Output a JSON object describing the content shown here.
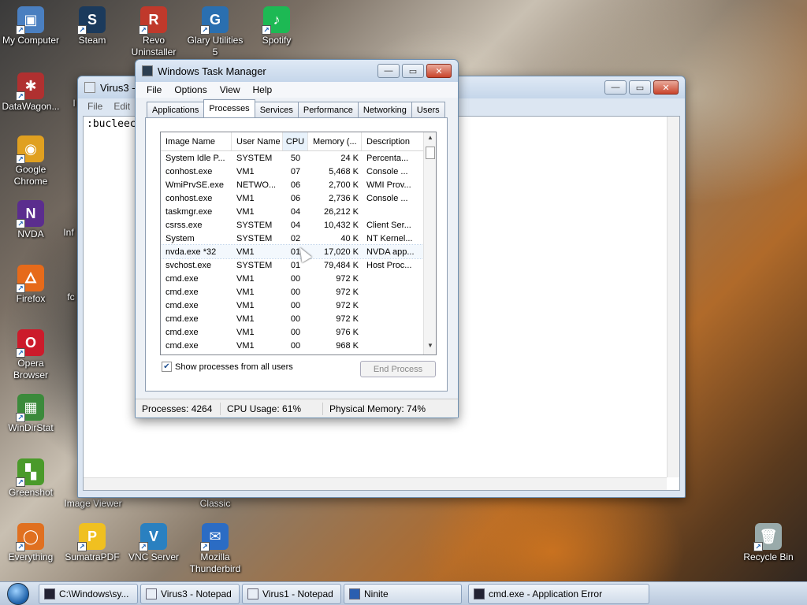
{
  "desktop_icons": [
    {
      "name": "My Computer",
      "color": "#4a7fc0",
      "glyph": "▣"
    },
    {
      "name": "Steam",
      "color": "#1b3a5c",
      "glyph": "S"
    },
    {
      "name": "Revo Uninstaller",
      "color": "#c0392b",
      "glyph": "R"
    },
    {
      "name": "Glary Utilities 5",
      "color": "#2a6fb0",
      "glyph": "G"
    },
    {
      "name": "Spotify",
      "color": "#1db954",
      "glyph": "♪"
    },
    {
      "name": "DataWagon...",
      "color": "#b03030",
      "glyph": "✱"
    },
    {
      "name": "Google Chrome",
      "color": "#e0a020",
      "glyph": "◉"
    },
    {
      "name": "NVDA",
      "color": "#5b2d8e",
      "glyph": "N"
    },
    {
      "name": "Firefox",
      "color": "#e66a1a",
      "glyph": "🜂"
    },
    {
      "name": "Opera Browser",
      "color": "#cc1b2b",
      "glyph": "O"
    },
    {
      "name": "WinDirStat",
      "color": "#3b8a3b",
      "glyph": "▦"
    },
    {
      "name": "Greenshot",
      "color": "#4a9a2a",
      "glyph": "▚"
    },
    {
      "name": "Everything",
      "color": "#e07020",
      "glyph": "◯"
    },
    {
      "name": "SumatraPDF",
      "color": "#f0c020",
      "glyph": "P"
    },
    {
      "name": "VNC Server",
      "color": "#2a80c0",
      "glyph": "V"
    },
    {
      "name": "Mozilla Thunderbird",
      "color": "#2b6cc4",
      "glyph": "✉"
    },
    {
      "name": "Recycle Bin",
      "color": "#9aa",
      "glyph": "🗑"
    }
  ],
  "partial_labels": {
    "inf": "Inf",
    "fc": "fc",
    "i": "I",
    "image_viewer": "Image Viewer",
    "classic": "Classic"
  },
  "notepad": {
    "title": "Virus3 - N",
    "menu": {
      "file": "File",
      "edit": "Edit"
    },
    "content": ":bucleec"
  },
  "taskmgr": {
    "title": "Windows Task Manager",
    "menu": {
      "file": "File",
      "options": "Options",
      "view": "View",
      "help": "Help"
    },
    "tabs": {
      "applications": "Applications",
      "processes": "Processes",
      "services": "Services",
      "performance": "Performance",
      "networking": "Networking",
      "users": "Users"
    },
    "columns": {
      "image": "Image Name",
      "user": "User Name",
      "cpu": "CPU",
      "memory": "Memory (...",
      "description": "Description"
    },
    "processes": [
      {
        "image": "System Idle P...",
        "user": "SYSTEM",
        "cpu": "50",
        "memory": "24 K",
        "description": "Percenta..."
      },
      {
        "image": "conhost.exe",
        "user": "VM1",
        "cpu": "07",
        "memory": "5,468 K",
        "description": "Console ..."
      },
      {
        "image": "WmiPrvSE.exe",
        "user": "NETWO...",
        "cpu": "06",
        "memory": "2,700 K",
        "description": "WMI Prov..."
      },
      {
        "image": "conhost.exe",
        "user": "VM1",
        "cpu": "06",
        "memory": "2,736 K",
        "description": "Console ..."
      },
      {
        "image": "taskmgr.exe",
        "user": "VM1",
        "cpu": "04",
        "memory": "26,212 K",
        "description": ""
      },
      {
        "image": "csrss.exe",
        "user": "SYSTEM",
        "cpu": "04",
        "memory": "10,432 K",
        "description": "Client Ser..."
      },
      {
        "image": "System",
        "user": "SYSTEM",
        "cpu": "02",
        "memory": "40 K",
        "description": "NT Kernel..."
      },
      {
        "image": "nvda.exe *32",
        "user": "VM1",
        "cpu": "01",
        "memory": "17,020 K",
        "description": "NVDA app..."
      },
      {
        "image": "svchost.exe",
        "user": "SYSTEM",
        "cpu": "01",
        "memory": "79,484 K",
        "description": "Host Proc..."
      },
      {
        "image": "cmd.exe",
        "user": "VM1",
        "cpu": "00",
        "memory": "972 K",
        "description": ""
      },
      {
        "image": "cmd.exe",
        "user": "VM1",
        "cpu": "00",
        "memory": "972 K",
        "description": ""
      },
      {
        "image": "cmd.exe",
        "user": "VM1",
        "cpu": "00",
        "memory": "972 K",
        "description": ""
      },
      {
        "image": "cmd.exe",
        "user": "VM1",
        "cpu": "00",
        "memory": "972 K",
        "description": ""
      },
      {
        "image": "cmd.exe",
        "user": "VM1",
        "cpu": "00",
        "memory": "976 K",
        "description": ""
      },
      {
        "image": "cmd.exe",
        "user": "VM1",
        "cpu": "00",
        "memory": "968 K",
        "description": ""
      }
    ],
    "show_all_label": "Show processes from all users",
    "show_all_checked": true,
    "end_process_label": "End Process",
    "status": {
      "processes": "Processes: 4264",
      "cpu": "CPU Usage: 61%",
      "memory": "Physical Memory: 74%"
    }
  },
  "taskbar": {
    "items": [
      {
        "label": "C:\\Windows\\sy...",
        "icon": "cmd-icon"
      },
      {
        "label": "Virus3 - Notepad",
        "icon": "notepad-icon"
      },
      {
        "label": "Virus1 - Notepad",
        "icon": "notepad-icon"
      },
      {
        "label": "Ninite",
        "icon": "ninite-icon"
      }
    ],
    "error_label": "cmd.exe - Application Error"
  }
}
